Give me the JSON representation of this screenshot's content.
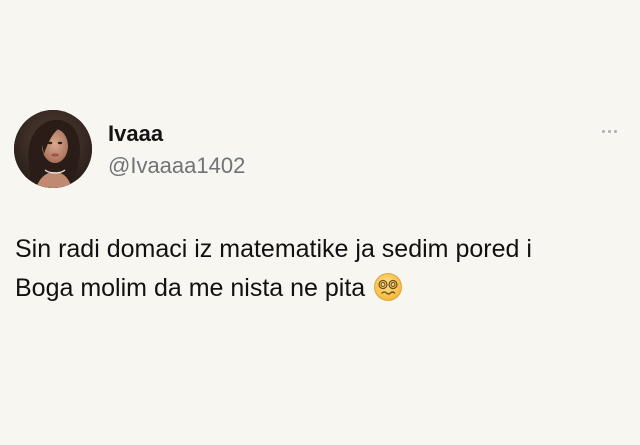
{
  "user": {
    "name": "Ivaaa",
    "handle": "@Ivaaaa1402",
    "avatar_icon": "profile-photo"
  },
  "more_menu": {
    "icon": "more-options-icon"
  },
  "tweet": {
    "line1": "Sin radi domaci iz matematike ja sedim pored i",
    "line2": "Boga molim da me nista ne pita",
    "emoji": "dizzy-face-emoji"
  },
  "colors": {
    "background": "#f8f6f0",
    "text": "#111111",
    "handle": "#6e7478",
    "more_dots": "#a9aeb2"
  }
}
